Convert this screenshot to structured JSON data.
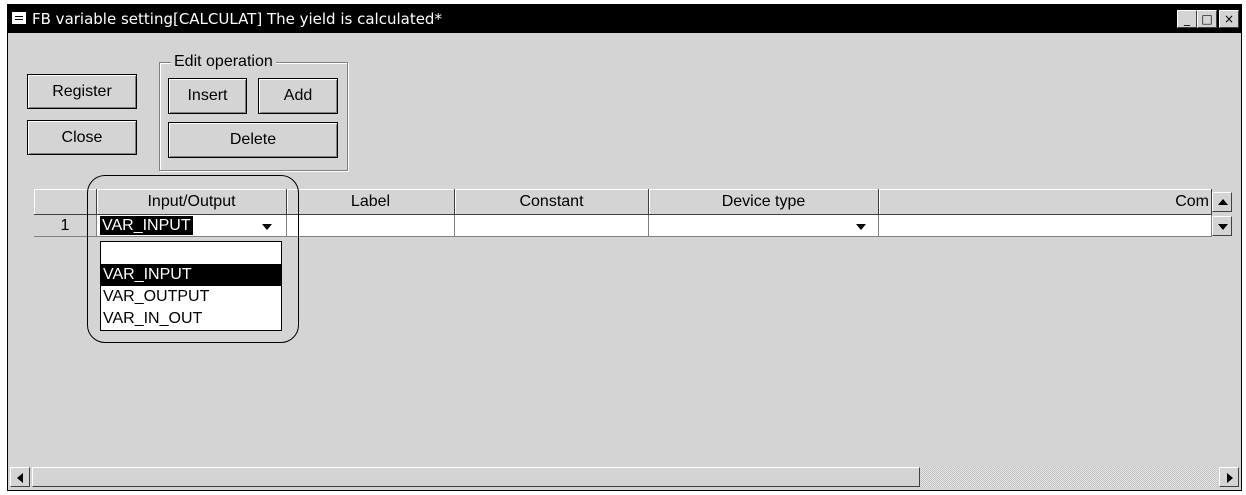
{
  "window": {
    "title": "FB variable setting[CALCULAT]  The yield is calculated*",
    "minimize_glyph": "_",
    "restore_glyph": "□",
    "close_glyph": "×"
  },
  "buttons": {
    "register": "Register",
    "close": "Close"
  },
  "edit_operation": {
    "legend": "Edit operation",
    "insert": "Insert",
    "add": "Add",
    "delete": "Delete"
  },
  "grid": {
    "columns": [
      "",
      "Input/Output",
      "Label",
      "Constant",
      "Device type",
      "Com"
    ],
    "rows": [
      {
        "number": "1",
        "io": "VAR_INPUT",
        "label": "",
        "constant": "",
        "device_type": "",
        "comment": ""
      }
    ]
  },
  "io_dropdown": {
    "options": [
      "",
      "VAR_INPUT",
      "VAR_OUTPUT",
      "VAR_IN_OUT"
    ],
    "selected": "VAR_INPUT"
  },
  "icons": {
    "system_menu": "window-icon",
    "dropdown": "chevron-down-icon",
    "scroll_left": "arrow-left-icon",
    "scroll_right": "arrow-right-icon",
    "scroll_up": "arrow-up-icon",
    "scroll_down": "arrow-down-icon"
  }
}
